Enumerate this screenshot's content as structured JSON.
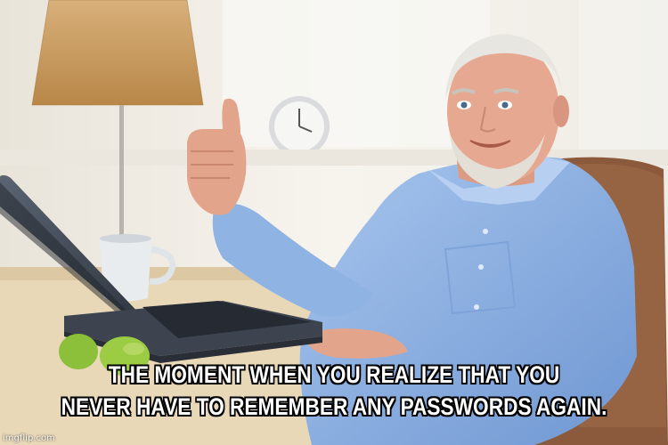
{
  "caption": {
    "line1": "THE MOMENT WHEN YOU REALIZE THAT YOU",
    "line2": "NEVER HAVE TO REMEMBER ANY PASSWORDS AGAIN."
  },
  "watermark": "imgflip.com",
  "colors": {
    "background": "#f3efe8",
    "shirt": "#8fb4e4",
    "skin": "#e3a48c",
    "hair": "#e8e6e0",
    "laptop": "#3d4450",
    "chair": "#8b5a3c",
    "desk": "#e8d8b8",
    "lampshade": "#c99a5c",
    "mug": "#e8ecef"
  }
}
